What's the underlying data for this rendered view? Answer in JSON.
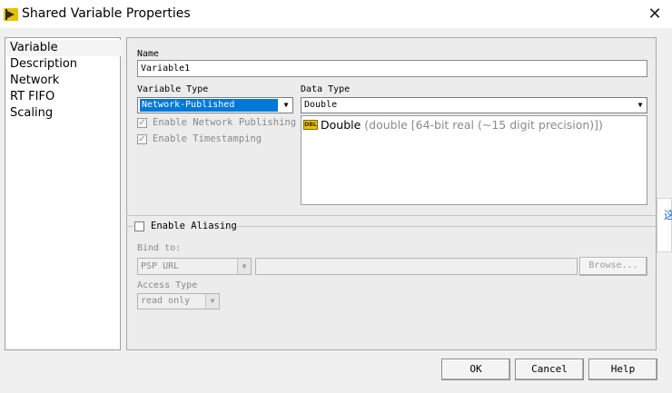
{
  "window": {
    "title": "Shared Variable Properties"
  },
  "nav": {
    "items": [
      "Variable",
      "Description",
      "Network",
      "RT FIFO",
      "Scaling"
    ],
    "selected": "Variable"
  },
  "name": {
    "label": "Name",
    "value": "Variable1"
  },
  "variable_type": {
    "label": "Variable Type",
    "value": "Network-Published"
  },
  "data_type": {
    "label": "Data Type",
    "value": "Double",
    "badge": "DBL",
    "item_name": "Double",
    "item_desc": "(double [64-bit real (~15 digit precision)])"
  },
  "options": {
    "enable_network_publishing": {
      "label": "Enable Network Publishing",
      "checked": true,
      "enabled": false
    },
    "enable_timestamping": {
      "label": "Enable Timestamping",
      "checked": true,
      "enabled": false
    }
  },
  "aliasing": {
    "label": "Enable Aliasing",
    "checked": false,
    "bind_to_label": "Bind to:",
    "bind_to_value": "PSP URL",
    "path_value": "",
    "browse_label": "Browse...",
    "access_type_label": "Access Type",
    "access_type_value": "read only"
  },
  "buttons": {
    "ok": "OK",
    "cancel": "Cancel",
    "help": "Help"
  },
  "edge_popup": {
    "text": "这"
  },
  "colors": {
    "selection": "#0078d7",
    "icon_yellow": "#e8c200",
    "panel_border": "#a8a8a8"
  }
}
